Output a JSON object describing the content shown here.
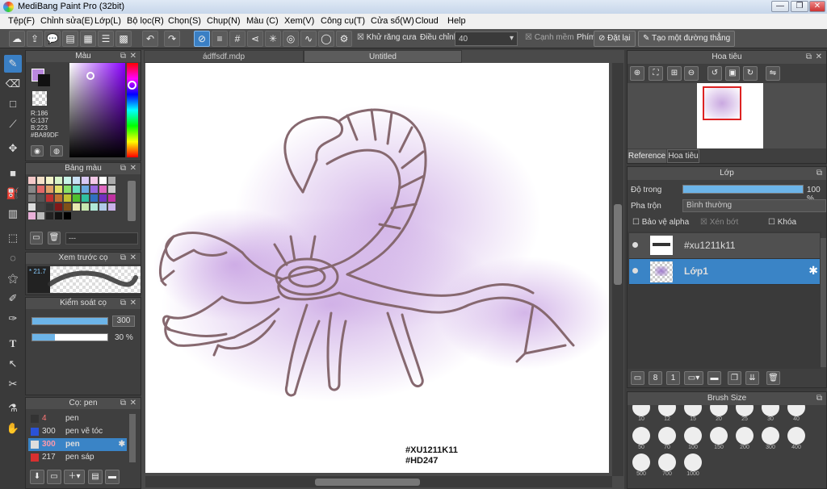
{
  "window": {
    "title": "MediBang Paint Pro (32bit)",
    "minimize": "—",
    "restore": "❐",
    "close": "✕"
  },
  "menu": [
    "Tệp(F)",
    "Chỉnh sửa(E)",
    "Lớp(L)",
    "Bộ lọc(R)",
    "Chọn(S)",
    "Chụp(N)",
    "Màu (C)",
    "Xem(V)",
    "Công cụ(T)",
    "Cửa sổ(W)",
    "Cloud",
    "Help"
  ],
  "toolbar": {
    "antialias_label": "Khử răng cưa",
    "correction_label": "Điều chỉnh",
    "correction_value": "40",
    "soft_edge_label": "Cạnh mềm",
    "key_label": "Phím",
    "reset_label": "Đặt lại",
    "create_line_label": "Tạo một đường thẳng"
  },
  "color_panel": {
    "title": "Màu",
    "r": "R:186",
    "g": "G:137",
    "b": "B:223",
    "hex": "#BA89DF",
    "fg_color": "#BA89DF"
  },
  "palette_panel": {
    "title": "Bảng màu",
    "dashes": "---"
  },
  "preview_panel": {
    "title": "Xem trước cọ",
    "size": "21.7"
  },
  "brush_control": {
    "title": "Kiểm soát cọ",
    "size": "300",
    "opacity": "30 %",
    "size_fraction": 1.0,
    "opacity_fraction": 0.3
  },
  "brush_list": {
    "title": "Cọ: pen",
    "items": [
      {
        "size": "4",
        "name": "pen",
        "color": "#333333"
      },
      {
        "size": "300",
        "name": "pen vẽ tóc",
        "color": "#2a52d8"
      },
      {
        "size": "300",
        "name": "pen",
        "color": "#dddddd"
      },
      {
        "size": "217",
        "name": "pen sáp",
        "color": "#d83030"
      }
    ]
  },
  "tabs": [
    "ádffsdf.mdp",
    "Untitled"
  ],
  "canvas": {
    "watermark1": "#XU1211K11",
    "watermark2": "#HD247"
  },
  "navigator": {
    "title": "Hoa tiêu",
    "tab_reference": "Reference",
    "tab_navigator": "Hoa tiêu"
  },
  "layers": {
    "title": "Lớp",
    "opacity_label": "Độ trong",
    "opacity_value": "100 %",
    "opacity_fraction": 1.0,
    "blend_label": "Pha trộn",
    "blend_value": "Bình thường",
    "protect_alpha": "Bảo vệ alpha",
    "clipping": "Xén bớt",
    "lock": "Khóa",
    "items": [
      {
        "name": "#xu1211k11"
      },
      {
        "name": "Lớp1"
      }
    ]
  },
  "brush_size": {
    "title": "Brush Size",
    "sizes": [
      "10",
      "12",
      "15",
      "20",
      "25",
      "30",
      "40",
      "50",
      "70",
      "100",
      "150",
      "200",
      "300",
      "400",
      "500",
      "700",
      "1000"
    ]
  },
  "colors": {
    "accent": "#3a84c6",
    "panel": "#3f3f3f"
  }
}
